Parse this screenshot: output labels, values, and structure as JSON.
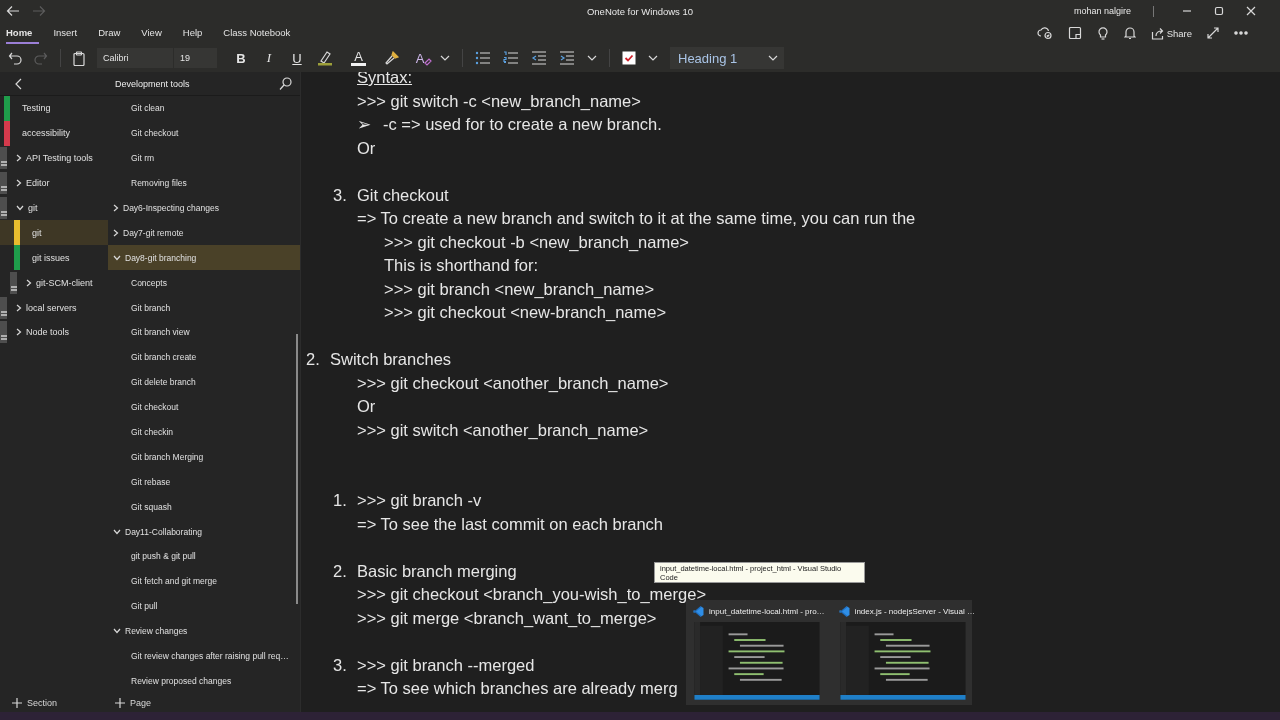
{
  "window": {
    "title": "OneNote for Windows 10",
    "user": "mohan nalgire"
  },
  "ribbon_tabs": [
    {
      "label": "Home",
      "selected": true
    },
    {
      "label": "Insert",
      "selected": false
    },
    {
      "label": "Draw",
      "selected": false
    },
    {
      "label": "View",
      "selected": false
    },
    {
      "label": "Help",
      "selected": false
    },
    {
      "label": "Class Notebook",
      "selected": false
    }
  ],
  "toolbar": {
    "font": "Calibri",
    "size": "19",
    "format_buttons": [
      "B",
      "I",
      "U"
    ],
    "font_color": "A",
    "clear_formatting": "A",
    "style": "Heading 1",
    "share": "Share"
  },
  "sidebar": {
    "title": "Development tools",
    "sections": [
      {
        "label": "Testing",
        "kind": "section",
        "color": "#1f9d4b",
        "selected": false
      },
      {
        "label": "accessibility",
        "kind": "section",
        "color": "#d43a4c",
        "selected": false
      },
      {
        "label": "API Testing tools",
        "kind": "group",
        "expanded": false,
        "selected": false
      },
      {
        "label": "Editor",
        "kind": "group",
        "expanded": false,
        "selected": false
      },
      {
        "label": "git",
        "kind": "group",
        "expanded": true,
        "selected": false,
        "children": [
          {
            "label": "git",
            "kind": "section",
            "color": "#e8bd2e",
            "selected": true
          },
          {
            "label": "git issues",
            "kind": "section",
            "color": "#1f9d4b",
            "selected": false
          },
          {
            "label": "git-SCM-client",
            "kind": "group",
            "expanded": false,
            "selected": false
          }
        ]
      },
      {
        "label": "local servers",
        "kind": "group",
        "expanded": false,
        "selected": false
      },
      {
        "label": "Node tools",
        "kind": "group",
        "expanded": false,
        "selected": false
      }
    ],
    "pages": [
      {
        "kind": "continued",
        "children": [
          {
            "label": "Git clean",
            "kind": "page",
            "selected": false
          },
          {
            "label": "Git checkout",
            "kind": "page",
            "selected": false
          },
          {
            "label": "Git rm",
            "kind": "page",
            "selected": false
          },
          {
            "label": "Removing files",
            "kind": "page",
            "selected": false
          }
        ]
      },
      {
        "label": "Day6-Inspecting changes",
        "kind": "group",
        "expanded": false,
        "selected": false
      },
      {
        "label": "Day7-git remote",
        "kind": "group",
        "expanded": false,
        "selected": false
      },
      {
        "label": "Day8-git branching",
        "kind": "group",
        "expanded": true,
        "selected": true,
        "children": [
          {
            "label": "Concepts",
            "kind": "page",
            "selected": false
          },
          {
            "label": "Git branch",
            "kind": "page",
            "selected": false
          },
          {
            "label": "Git branch view",
            "kind": "page",
            "selected": false
          },
          {
            "label": "Git branch create",
            "kind": "page",
            "selected": false
          },
          {
            "label": "Git delete branch",
            "kind": "page",
            "selected": false
          },
          {
            "label": "Git checkout",
            "kind": "page",
            "selected": false
          },
          {
            "label": "Git checkin",
            "kind": "page",
            "selected": false
          },
          {
            "label": "Git branch Merging",
            "kind": "page",
            "selected": false
          },
          {
            "label": "Git rebase",
            "kind": "page",
            "selected": false
          },
          {
            "label": "Git squash",
            "kind": "page",
            "selected": false
          }
        ]
      },
      {
        "label": "Day11-Collaborating",
        "kind": "group",
        "expanded": true,
        "selected": false,
        "children": [
          {
            "label": "git push & git pull",
            "kind": "page",
            "selected": false
          },
          {
            "label": "Git fetch and git merge",
            "kind": "page",
            "selected": false
          },
          {
            "label": "Git pull",
            "kind": "page",
            "selected": false
          }
        ]
      },
      {
        "label": "Review changes",
        "kind": "group",
        "expanded": true,
        "selected": false,
        "children": [
          {
            "label": "Git review changes after raising pull req…",
            "kind": "page",
            "selected": false
          },
          {
            "label": "Review proposed changes",
            "kind": "page",
            "selected": false
          }
        ]
      }
    ],
    "add_section": "Section",
    "add_page": "Page"
  },
  "note": {
    "items": [
      {
        "kind": "group",
        "children": [
          {
            "kind": "text",
            "text": "Syntax:",
            "underline": true
          },
          {
            "kind": "text",
            "text": ">>> git switch -c <new_branch_name>"
          },
          {
            "kind": "bullet",
            "marker": "➢",
            "text": "-c => used for to create a new branch."
          },
          {
            "kind": "text",
            "text": "Or"
          },
          {
            "kind": "blank"
          },
          {
            "kind": "numbered",
            "number": "3.",
            "text": "Git checkout"
          },
          {
            "kind": "text",
            "text": "=> To create a new branch and switch to it at the same time, you can run the",
            "children": [
              {
                "kind": "text",
                "text": ">>> git checkout -b <new_branch_name>"
              },
              {
                "kind": "text",
                "text": "This is shorthand for:"
              },
              {
                "kind": "text",
                "text": ">>> git branch <new_branch_name>"
              },
              {
                "kind": "text",
                "text": ">>> git checkout <new-branch_name>"
              }
            ]
          },
          {
            "kind": "blank"
          }
        ]
      },
      {
        "kind": "numbered",
        "number": "2.",
        "text": "Switch branches",
        "children": [
          {
            "kind": "text",
            "text": ">>> git checkout <another_branch_name>"
          },
          {
            "kind": "text",
            "text": "Or"
          },
          {
            "kind": "text",
            "text": ">>> git switch <another_branch_name>"
          },
          {
            "kind": "blank"
          },
          {
            "kind": "blank"
          },
          {
            "kind": "numbered",
            "number": "1.",
            "text": ">>> git branch -v"
          },
          {
            "kind": "text",
            "text": "=> To see the last commit on each branch"
          },
          {
            "kind": "blank"
          },
          {
            "kind": "numbered",
            "number": "2.",
            "text": "Basic branch merging"
          },
          {
            "kind": "text",
            "text": ">>> git checkout <branch_you-wish_to_merge>"
          },
          {
            "kind": "text",
            "text": ">>> git merge <branch_want_to_merge>"
          },
          {
            "kind": "blank"
          },
          {
            "kind": "numbered",
            "number": "3.",
            "text": ">>> git branch --merged"
          },
          {
            "kind": "text",
            "text": "=> To see which branches are already merg"
          }
        ]
      }
    ]
  },
  "taskbar_preview": {
    "tooltip": "input_datetime-local.html - project_html - Visual Studio Code",
    "windows": [
      {
        "title": "input_datetime-local.html - pro…"
      },
      {
        "title": "index.js - nodejsServer - Visual …"
      }
    ]
  }
}
